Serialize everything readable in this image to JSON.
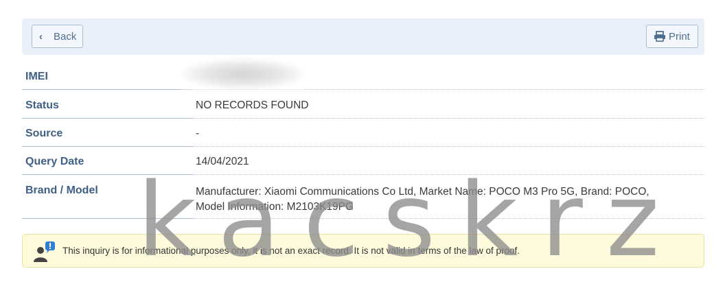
{
  "toolbar": {
    "back_label": "Back",
    "print_label": "Print"
  },
  "details": [
    {
      "label": "IMEI",
      "value": ""
    },
    {
      "label": "Status",
      "value": "NO RECORDS FOUND"
    },
    {
      "label": "Source",
      "value": "-"
    },
    {
      "label": "Query Date",
      "value": "14/04/2021"
    },
    {
      "label": "Brand / Model",
      "value_line1": "Manufacturer: Xiaomi Communications Co Ltd, Market Name: POCO M3 Pro 5G, Brand: POCO,",
      "value_line2": "Model Information: M2103K19PG"
    }
  ],
  "notice": {
    "text": "This inquiry is for informational purposes only, it is not an exact record. It is not valid in terms of the law of proof.",
    "icon": "user-info-icon"
  },
  "watermark": "kacskrz",
  "colors": {
    "toolbar_bg": "#e9f0f8",
    "label": "#3f5f86",
    "notice_bg": "#fdfbdc"
  }
}
